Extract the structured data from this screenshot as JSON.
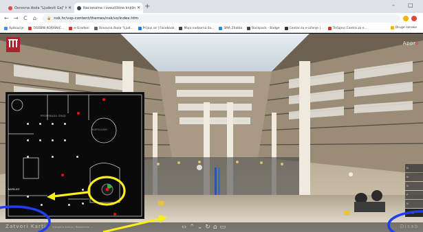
{
  "browser": {
    "tabs": [
      {
        "title": "Osnovna škola \"Ljudevit Gaj\" Kriz",
        "fav_color": "#e54848"
      },
      {
        "title": "Nacionalna i sveučilišna knjižnica",
        "fav_color": "#3c4043"
      }
    ],
    "new_tab": "+",
    "controls": {
      "minimize": "–",
      "maximize": "□"
    },
    "nav": {
      "back": "←",
      "forward": "→",
      "reload": "C",
      "home": "⌂"
    },
    "url": "nsk.hr/vsp-content/themes/nsk/vs/index.htm",
    "lock": "🔒",
    "bookmarks": [
      {
        "label": "Aplikacije",
        "color": "#4a8af4"
      },
      {
        "label": "OSOBNI KORISNIC...",
        "color": "#d93025"
      },
      {
        "label": "e-Građani",
        "color": "#d93025"
      },
      {
        "label": "Osnovna škola \"Ljud...",
        "color": "#5f6368"
      },
      {
        "label": "Prijavi se | Facebook",
        "color": "#1877f2"
      },
      {
        "label": "Moja nadzorna ša...",
        "color": "#3c4043"
      },
      {
        "label": "SMA Zhalba",
        "color": "#1e88e5"
      },
      {
        "label": "Backpack - Badge",
        "color": "#444"
      },
      {
        "label": "Centar za e-učenje |...",
        "color": "#333"
      },
      {
        "label": "Tečajevi Centra za e...",
        "color": "#d93025"
      }
    ],
    "other_bookmarks": "Druge oznake"
  },
  "viewer": {
    "brand_a": "Appr",
    "brand_b": "o",
    "minimap": {
      "rooms": [
        "PROMINADA GRAD",
        "KUPOLASKI",
        "KAPELICE"
      ],
      "position_label": "KAPELICE"
    },
    "bottom": {
      "close_map": "Zatvori Karti",
      "credit": "Virtualna šetnja | Realizirala: ...",
      "controls": [
        "‹›",
        "⌃",
        "⌄",
        "↻",
        "⌂",
        "▭"
      ],
      "dist": "Disab"
    },
    "side_panel": [
      "N",
      "N",
      "N",
      "P",
      "N",
      "Pokaz",
      "Bez",
      "Rozman"
    ]
  }
}
